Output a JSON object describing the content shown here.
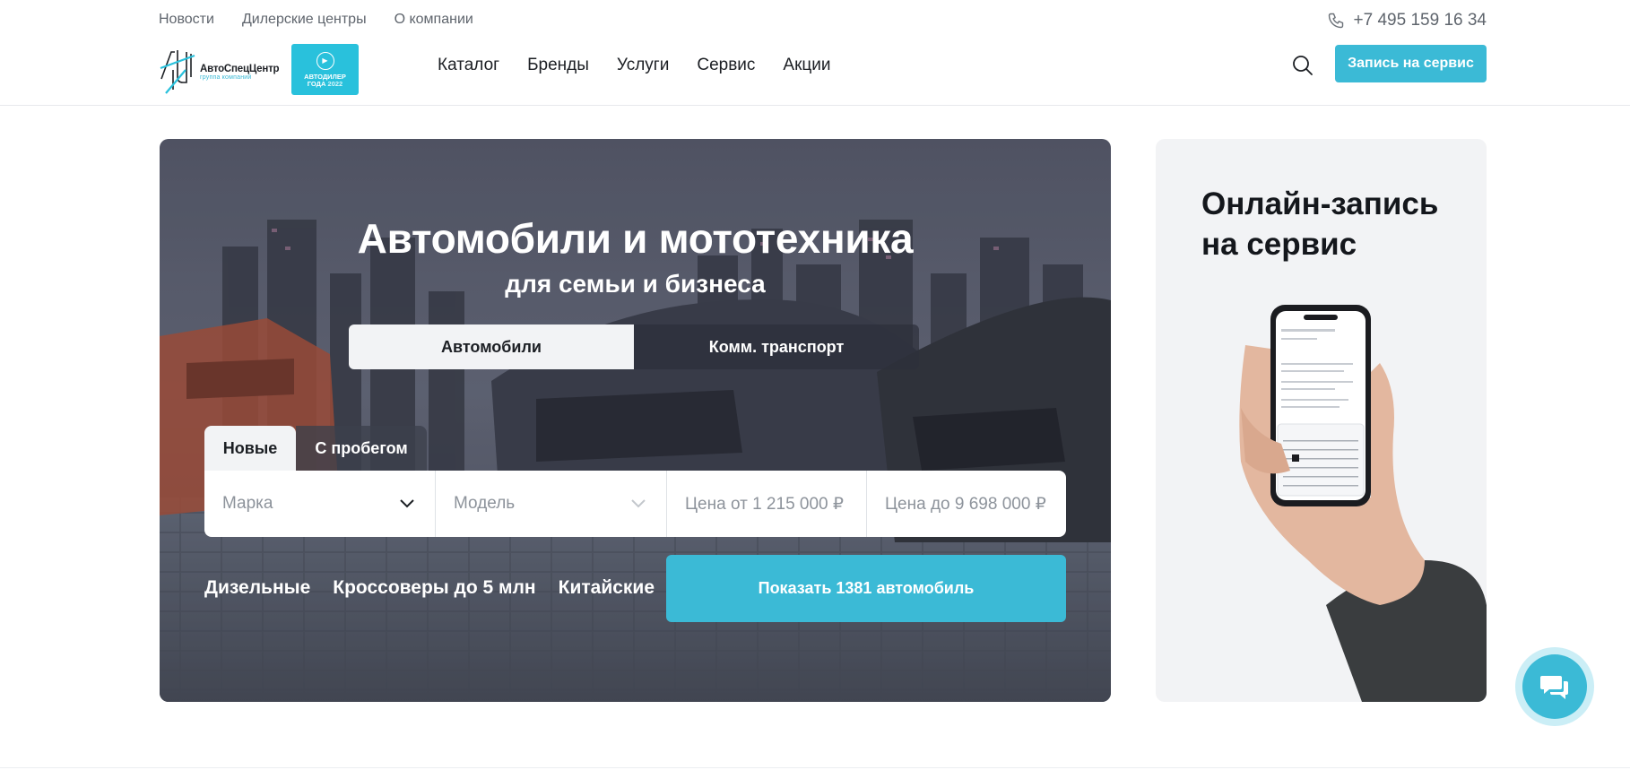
{
  "header": {
    "top_links": [
      "Новости",
      "Дилерские центры",
      "О компании"
    ],
    "phone": "+7 495 159 16 34",
    "logo": {
      "name": "АвтоСпецЦентр",
      "sub": "группа компаний"
    },
    "award": {
      "line1": "АВТОДИЛЕР",
      "line2": "ГОДА",
      "year": "2022"
    },
    "nav": [
      "Каталог",
      "Бренды",
      "Услуги",
      "Сервис",
      "Акции"
    ],
    "cta": "Запись на сервис"
  },
  "hero": {
    "title": "Автомобили и мототехника",
    "subtitle": "для семьи и бизнеса",
    "category_tabs": [
      "Автомобили",
      "Комм. транспорт"
    ],
    "condition_tabs": [
      "Новые",
      "С пробегом"
    ],
    "filters": {
      "brand": "Марка",
      "model": "Модель",
      "price_from": "Цена от 1 215 000 ₽",
      "price_to": "Цена до 9 698 000 ₽"
    },
    "quick_links": [
      "Дизельные",
      "Кроссоверы до 5 млн",
      "Китайские"
    ],
    "show_button": "Показать 1381 автомобиль"
  },
  "promo": {
    "title": "Онлайн-запись на сервис"
  },
  "colors": {
    "accent": "#3bbad6",
    "text": "#1c1f24",
    "muted": "#5f656d",
    "panel": "#f2f3f5"
  }
}
